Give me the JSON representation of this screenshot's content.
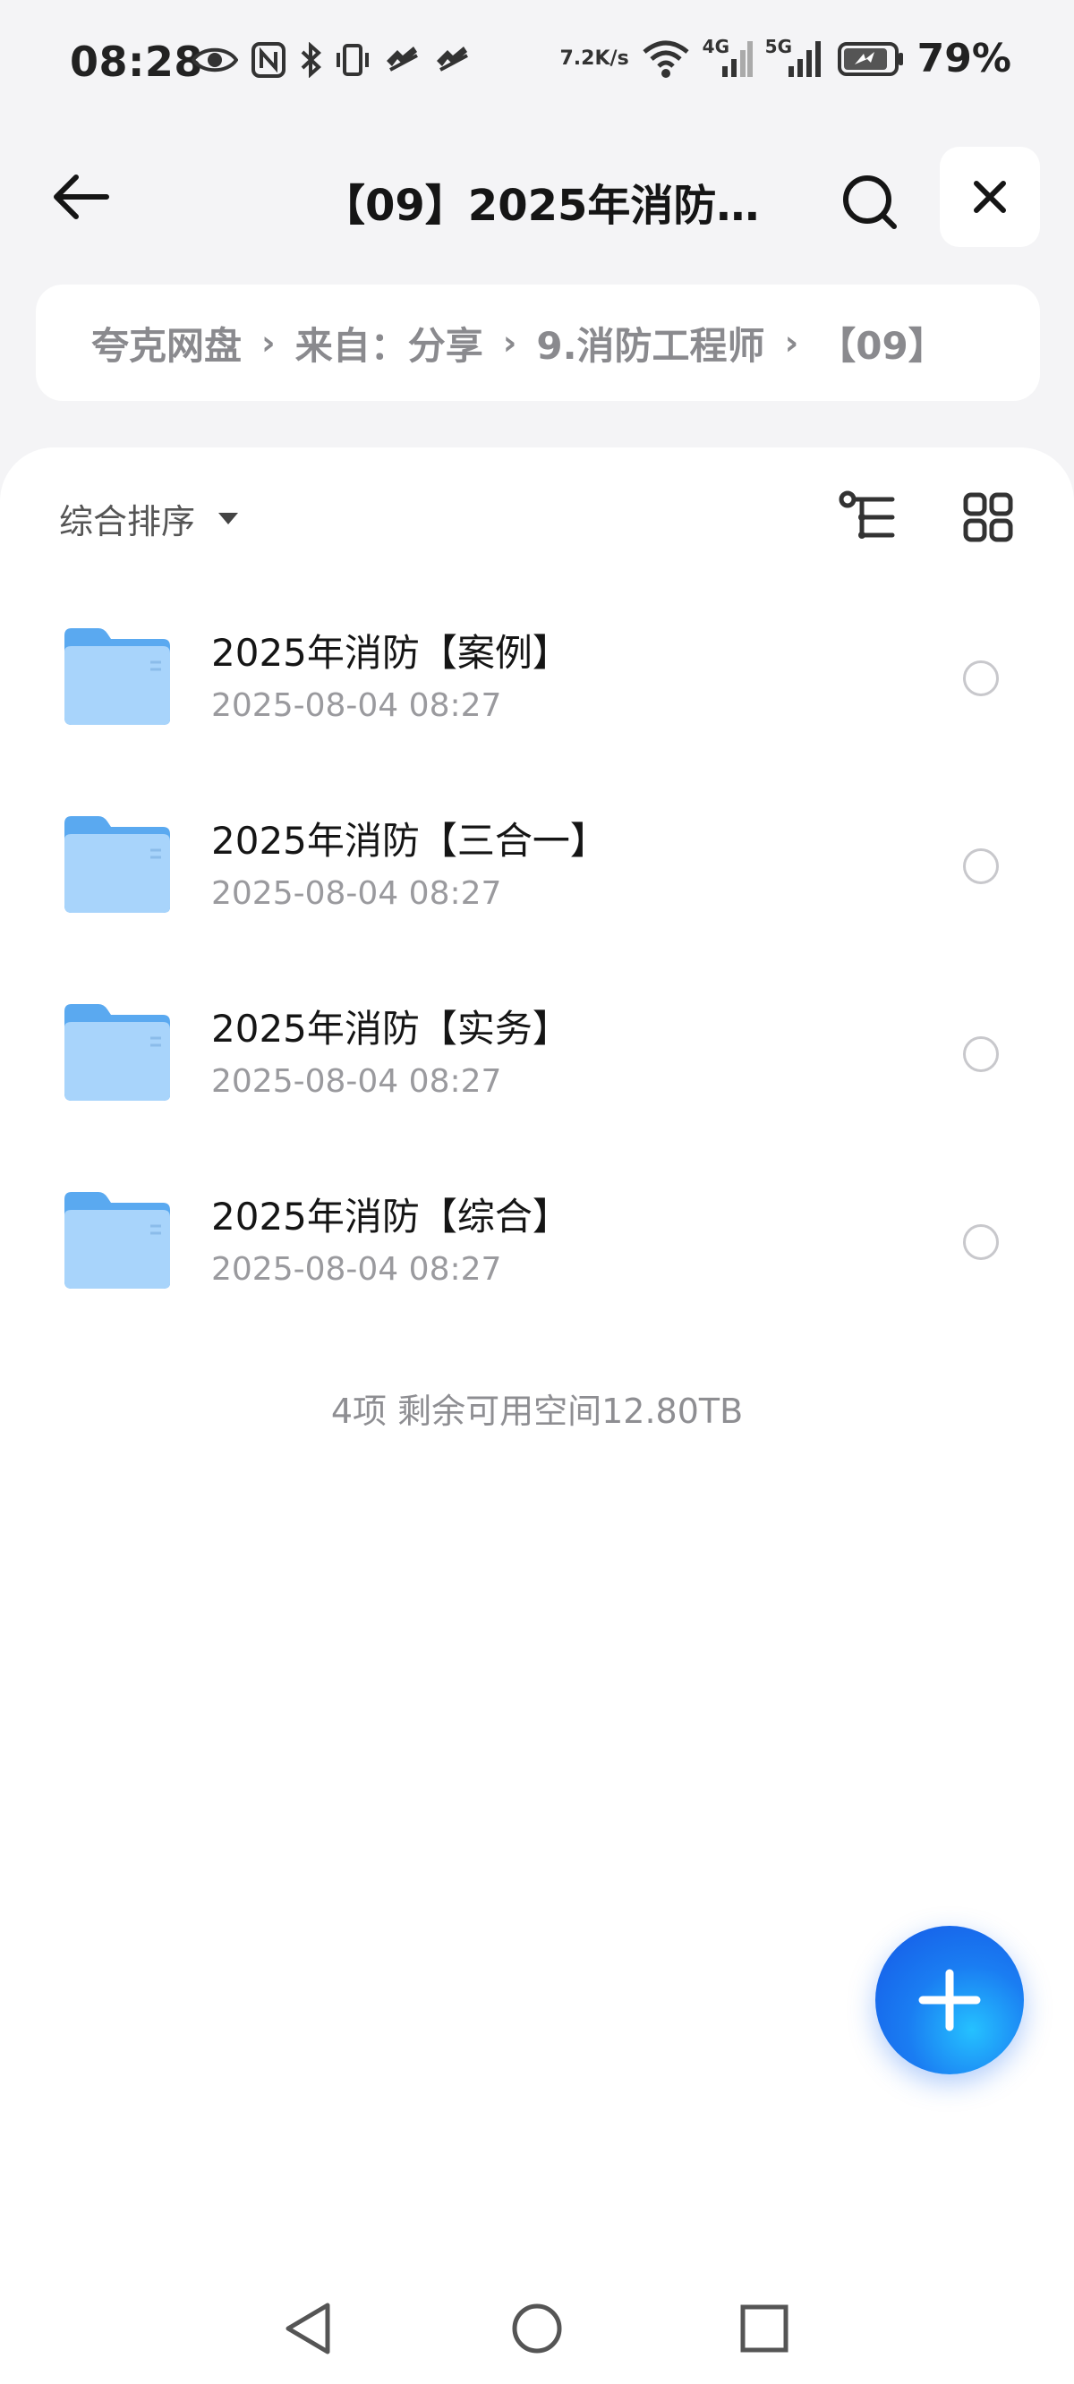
{
  "status_bar": {
    "time": "08:28",
    "net_speed_top": "7.2",
    "net_speed_bottom": "K/s",
    "net_4g": "4G",
    "net_5g": "5G",
    "battery": "79%"
  },
  "header": {
    "title": "【09】2025年消防…"
  },
  "breadcrumb": {
    "items": [
      "夸克网盘",
      "来自：分享",
      "9.消防工程师",
      "【09】"
    ]
  },
  "toolbar": {
    "sort_label": "综合排序"
  },
  "files": [
    {
      "name": "2025年消防【案例】",
      "date": "2025-08-04 08:27"
    },
    {
      "name": "2025年消防【三合一】",
      "date": "2025-08-04 08:27"
    },
    {
      "name": "2025年消防【实务】",
      "date": "2025-08-04 08:27"
    },
    {
      "name": "2025年消防【综合】",
      "date": "2025-08-04 08:27"
    }
  ],
  "summary": "4项 剩余可用空间12.80TB",
  "colors": {
    "accent": "#1a7df2",
    "folder": "#5aa9f0",
    "background": "#f4f4f6"
  }
}
